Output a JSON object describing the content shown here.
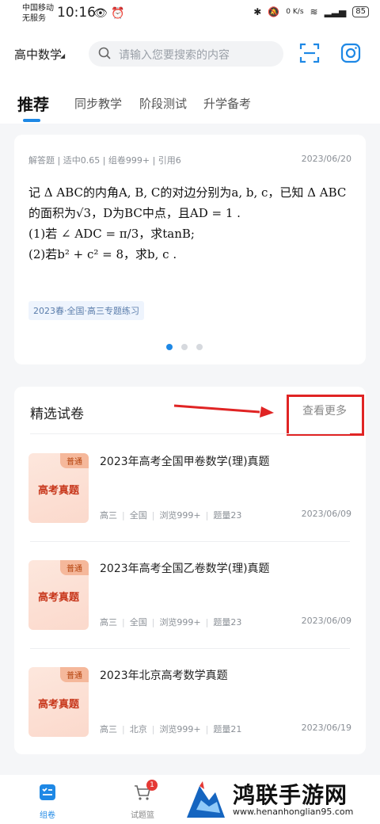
{
  "status_bar": {
    "carrier_line1": "中国移动",
    "carrier_line2": "无服务",
    "time": "10:16",
    "speed": "0 K/s",
    "battery": "85"
  },
  "header": {
    "subject": "高中数学",
    "search_placeholder": "请输入您要搜索的内容"
  },
  "tabs": [
    {
      "label": "推荐",
      "active": true
    },
    {
      "label": "同步教学"
    },
    {
      "label": "阶段测试"
    },
    {
      "label": "升学备考"
    }
  ],
  "question_card": {
    "meta": "解答题 | 适中0.65 | 组卷999+ | 引用6",
    "date": "2023/06/20",
    "lines": [
      "记 Δ ABC的内角A, B, C的对边分别为a, b, c，已知 Δ ABC",
      "的面积为√3，D为BC中点，且AD = 1 .",
      "(1)若 ∠ ADC = π/3，求tanB;",
      "(2)若b² + c² = 8，求b, c ."
    ],
    "tag": "2023春·全国·高三专题练习",
    "page_index": 1,
    "page_count": 3
  },
  "papers": {
    "title": "精选试卷",
    "more_label": "查看更多",
    "items": [
      {
        "badge": "普通",
        "thumb_label": "高考真题",
        "title": "2023年高考全国甲卷数学(理)真题",
        "grade": "高三",
        "region": "全国",
        "views": "浏览999+",
        "count": "题量23",
        "date": "2023/06/09"
      },
      {
        "badge": "普通",
        "thumb_label": "高考真题",
        "title": "2023年高考全国乙卷数学(理)真题",
        "grade": "高三",
        "region": "全国",
        "views": "浏览999+",
        "count": "题量23",
        "date": "2023/06/09"
      },
      {
        "badge": "普通",
        "thumb_label": "高考真题",
        "title": "2023年北京高考数学真题",
        "grade": "高三",
        "region": "北京",
        "views": "浏览999+",
        "count": "题量21",
        "date": "2023/06/19"
      }
    ]
  },
  "bottom_nav": {
    "items": [
      {
        "label": "组卷",
        "active": true
      },
      {
        "label": "试题篮",
        "badge": "1"
      }
    ]
  },
  "watermark": {
    "title": "鸿联手游网",
    "url": "www.henanhonglian95.com"
  },
  "colors": {
    "accent": "#1e88e5",
    "highlight": "#e02424",
    "thumb_text": "#c7361a"
  }
}
